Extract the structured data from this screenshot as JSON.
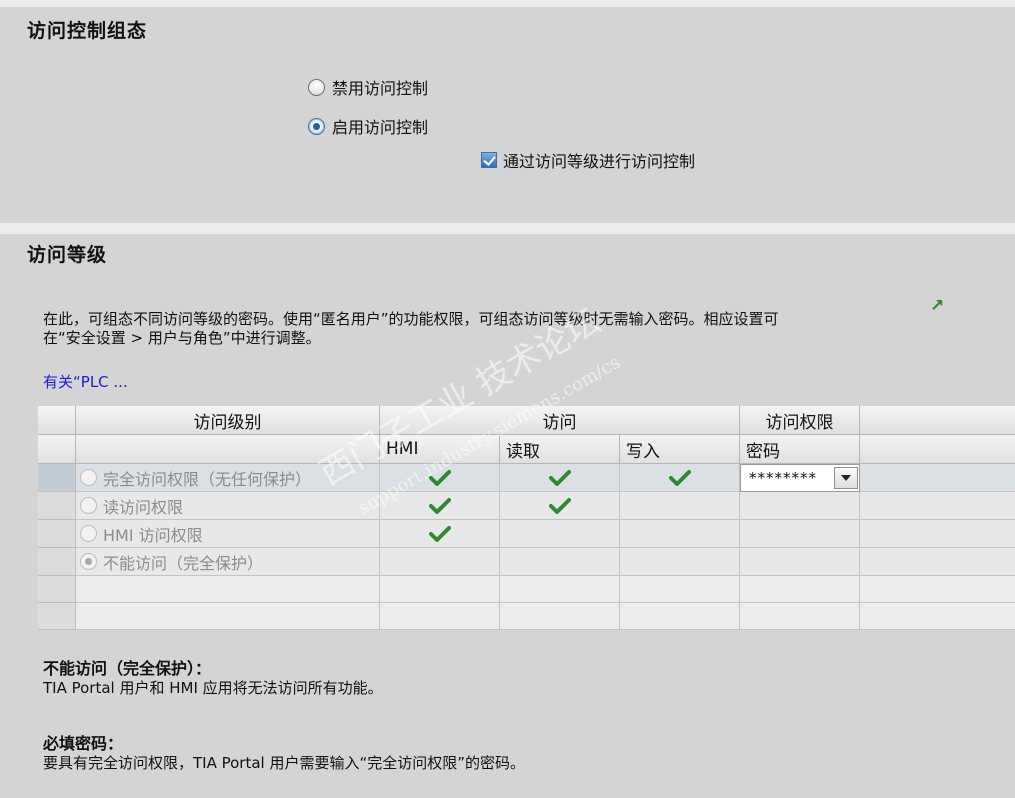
{
  "section1": {
    "title": "访问控制组态",
    "options": [
      {
        "label": "禁用访问控制",
        "selected": false
      },
      {
        "label": "启用访问控制",
        "selected": true
      }
    ],
    "checkbox": {
      "label": "通过访问等级进行访问控制",
      "checked": true
    }
  },
  "section2": {
    "title": "访问等级",
    "desc_line1": "在此，可组态不同访问等级的密码。使用“匿名用户”的功能权限，可组态访问等级时无需输入密码。相应设置可",
    "desc_line2": "在“安全设置 > 用户与角色”中进行调整。",
    "link": "有关“PLC ...",
    "table": {
      "headers": {
        "level": "访问级别",
        "access": "访问",
        "permission": "访问权限",
        "hmi": "HMI",
        "read": "读取",
        "write": "写入",
        "password": "密码"
      },
      "rows": [
        {
          "label": "完全访问权限（无任何保护）",
          "hmi": true,
          "read": true,
          "write": true,
          "password": "********",
          "selected": false
        },
        {
          "label": "读访问权限",
          "hmi": true,
          "read": true,
          "write": false,
          "password": "",
          "selected": false
        },
        {
          "label": "HMI 访问权限",
          "hmi": true,
          "read": false,
          "write": false,
          "password": "",
          "selected": false
        },
        {
          "label": "不能访问（完全保护）",
          "hmi": false,
          "read": false,
          "write": false,
          "password": "",
          "selected": true
        }
      ]
    },
    "notes": [
      {
        "title": "不能访问（完全保护）：",
        "text": "TIA Portal 用户和 HMI 应用将无法访问所有功能。"
      },
      {
        "title": "必填密码：",
        "text": "要具有完全访问权限，TIA Portal 用户需要输入“完全访问权限”的密码。"
      }
    ]
  },
  "watermark": {
    "cn": "西门子工业 技术论坛",
    "en": "support.industry.siemens.com/cs"
  },
  "colors": {
    "panel": "#d4d4d4",
    "check": "#2e8b2e",
    "link": "#1a1ad8",
    "selected_row": "#dbe0e5"
  }
}
